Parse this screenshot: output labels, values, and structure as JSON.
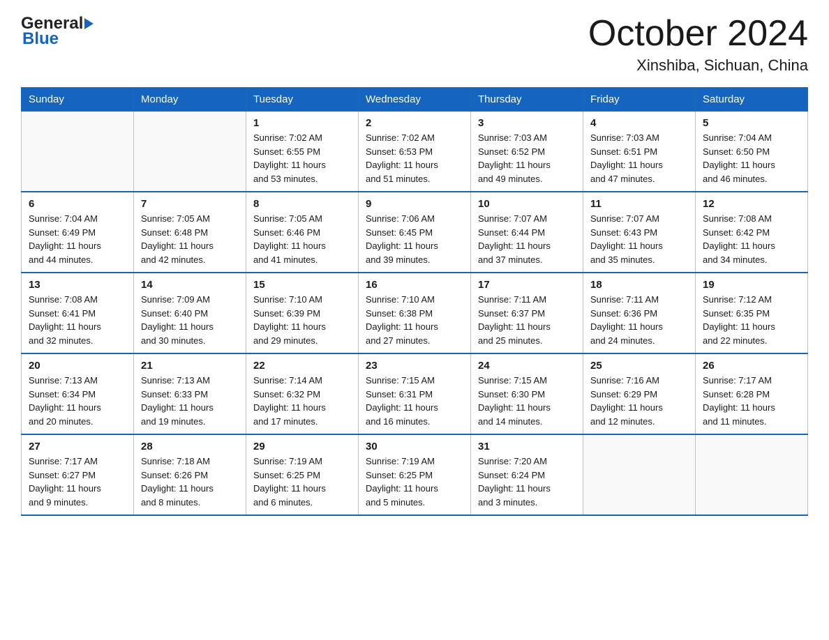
{
  "header": {
    "title": "October 2024",
    "subtitle": "Xinshiba, Sichuan, China"
  },
  "days_of_week": [
    "Sunday",
    "Monday",
    "Tuesday",
    "Wednesday",
    "Thursday",
    "Friday",
    "Saturday"
  ],
  "weeks": [
    [
      {
        "day": "",
        "info": ""
      },
      {
        "day": "",
        "info": ""
      },
      {
        "day": "1",
        "info": "Sunrise: 7:02 AM\nSunset: 6:55 PM\nDaylight: 11 hours\nand 53 minutes."
      },
      {
        "day": "2",
        "info": "Sunrise: 7:02 AM\nSunset: 6:53 PM\nDaylight: 11 hours\nand 51 minutes."
      },
      {
        "day": "3",
        "info": "Sunrise: 7:03 AM\nSunset: 6:52 PM\nDaylight: 11 hours\nand 49 minutes."
      },
      {
        "day": "4",
        "info": "Sunrise: 7:03 AM\nSunset: 6:51 PM\nDaylight: 11 hours\nand 47 minutes."
      },
      {
        "day": "5",
        "info": "Sunrise: 7:04 AM\nSunset: 6:50 PM\nDaylight: 11 hours\nand 46 minutes."
      }
    ],
    [
      {
        "day": "6",
        "info": "Sunrise: 7:04 AM\nSunset: 6:49 PM\nDaylight: 11 hours\nand 44 minutes."
      },
      {
        "day": "7",
        "info": "Sunrise: 7:05 AM\nSunset: 6:48 PM\nDaylight: 11 hours\nand 42 minutes."
      },
      {
        "day": "8",
        "info": "Sunrise: 7:05 AM\nSunset: 6:46 PM\nDaylight: 11 hours\nand 41 minutes."
      },
      {
        "day": "9",
        "info": "Sunrise: 7:06 AM\nSunset: 6:45 PM\nDaylight: 11 hours\nand 39 minutes."
      },
      {
        "day": "10",
        "info": "Sunrise: 7:07 AM\nSunset: 6:44 PM\nDaylight: 11 hours\nand 37 minutes."
      },
      {
        "day": "11",
        "info": "Sunrise: 7:07 AM\nSunset: 6:43 PM\nDaylight: 11 hours\nand 35 minutes."
      },
      {
        "day": "12",
        "info": "Sunrise: 7:08 AM\nSunset: 6:42 PM\nDaylight: 11 hours\nand 34 minutes."
      }
    ],
    [
      {
        "day": "13",
        "info": "Sunrise: 7:08 AM\nSunset: 6:41 PM\nDaylight: 11 hours\nand 32 minutes."
      },
      {
        "day": "14",
        "info": "Sunrise: 7:09 AM\nSunset: 6:40 PM\nDaylight: 11 hours\nand 30 minutes."
      },
      {
        "day": "15",
        "info": "Sunrise: 7:10 AM\nSunset: 6:39 PM\nDaylight: 11 hours\nand 29 minutes."
      },
      {
        "day": "16",
        "info": "Sunrise: 7:10 AM\nSunset: 6:38 PM\nDaylight: 11 hours\nand 27 minutes."
      },
      {
        "day": "17",
        "info": "Sunrise: 7:11 AM\nSunset: 6:37 PM\nDaylight: 11 hours\nand 25 minutes."
      },
      {
        "day": "18",
        "info": "Sunrise: 7:11 AM\nSunset: 6:36 PM\nDaylight: 11 hours\nand 24 minutes."
      },
      {
        "day": "19",
        "info": "Sunrise: 7:12 AM\nSunset: 6:35 PM\nDaylight: 11 hours\nand 22 minutes."
      }
    ],
    [
      {
        "day": "20",
        "info": "Sunrise: 7:13 AM\nSunset: 6:34 PM\nDaylight: 11 hours\nand 20 minutes."
      },
      {
        "day": "21",
        "info": "Sunrise: 7:13 AM\nSunset: 6:33 PM\nDaylight: 11 hours\nand 19 minutes."
      },
      {
        "day": "22",
        "info": "Sunrise: 7:14 AM\nSunset: 6:32 PM\nDaylight: 11 hours\nand 17 minutes."
      },
      {
        "day": "23",
        "info": "Sunrise: 7:15 AM\nSunset: 6:31 PM\nDaylight: 11 hours\nand 16 minutes."
      },
      {
        "day": "24",
        "info": "Sunrise: 7:15 AM\nSunset: 6:30 PM\nDaylight: 11 hours\nand 14 minutes."
      },
      {
        "day": "25",
        "info": "Sunrise: 7:16 AM\nSunset: 6:29 PM\nDaylight: 11 hours\nand 12 minutes."
      },
      {
        "day": "26",
        "info": "Sunrise: 7:17 AM\nSunset: 6:28 PM\nDaylight: 11 hours\nand 11 minutes."
      }
    ],
    [
      {
        "day": "27",
        "info": "Sunrise: 7:17 AM\nSunset: 6:27 PM\nDaylight: 11 hours\nand 9 minutes."
      },
      {
        "day": "28",
        "info": "Sunrise: 7:18 AM\nSunset: 6:26 PM\nDaylight: 11 hours\nand 8 minutes."
      },
      {
        "day": "29",
        "info": "Sunrise: 7:19 AM\nSunset: 6:25 PM\nDaylight: 11 hours\nand 6 minutes."
      },
      {
        "day": "30",
        "info": "Sunrise: 7:19 AM\nSunset: 6:25 PM\nDaylight: 11 hours\nand 5 minutes."
      },
      {
        "day": "31",
        "info": "Sunrise: 7:20 AM\nSunset: 6:24 PM\nDaylight: 11 hours\nand 3 minutes."
      },
      {
        "day": "",
        "info": ""
      },
      {
        "day": "",
        "info": ""
      }
    ]
  ]
}
